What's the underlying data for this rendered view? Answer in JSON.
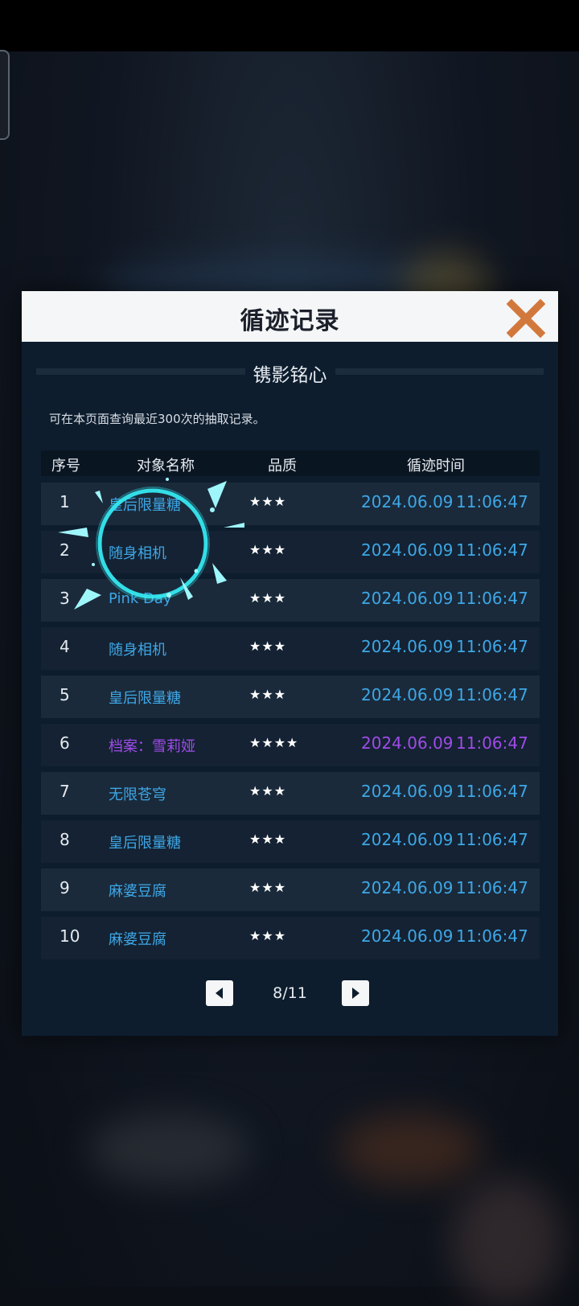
{
  "dialog": {
    "title": "循迹记录",
    "subtitle": "镌影铭心",
    "notice": "可在本页面查询最近300次的抽取记录。",
    "columns": {
      "no": "序号",
      "name": "对象名称",
      "quality": "品质",
      "time": "循迹时间"
    }
  },
  "rows": [
    {
      "no": "1",
      "name": "皇后限量糖",
      "quality": "★★★",
      "date": "2024.06.09",
      "time": "11:06:47"
    },
    {
      "no": "2",
      "name": "随身相机",
      "quality": "★★★",
      "date": "2024.06.09",
      "time": "11:06:47"
    },
    {
      "no": "3",
      "name": "Pink Day",
      "quality": "★★★",
      "date": "2024.06.09",
      "time": "11:06:47"
    },
    {
      "no": "4",
      "name": "随身相机",
      "quality": "★★★",
      "date": "2024.06.09",
      "time": "11:06:47"
    },
    {
      "no": "5",
      "name": "皇后限量糖",
      "quality": "★★★",
      "date": "2024.06.09",
      "time": "11:06:47"
    },
    {
      "no": "6",
      "name": "档案：雪莉娅",
      "quality": "★★★★",
      "date": "2024.06.09",
      "time": "11:06:47"
    },
    {
      "no": "7",
      "name": "无限苍穹",
      "quality": "★★★",
      "date": "2024.06.09",
      "time": "11:06:47"
    },
    {
      "no": "8",
      "name": "皇后限量糖",
      "quality": "★★★",
      "date": "2024.06.09",
      "time": "11:06:47"
    },
    {
      "no": "9",
      "name": "麻婆豆腐",
      "quality": "★★★",
      "date": "2024.06.09",
      "time": "11:06:47"
    },
    {
      "no": "10",
      "name": "麻婆豆腐",
      "quality": "★★★",
      "date": "2024.06.09",
      "time": "11:06:47"
    }
  ],
  "pagination": {
    "label": "8/11"
  },
  "icons": {
    "close": "close-x-icon",
    "prev": "triangle-left-icon",
    "next": "triangle-right-icon"
  },
  "colors": {
    "accent_blue": "#3ea7e6",
    "rare_purple": "#a04be8",
    "close_orange": "#d2783c"
  }
}
